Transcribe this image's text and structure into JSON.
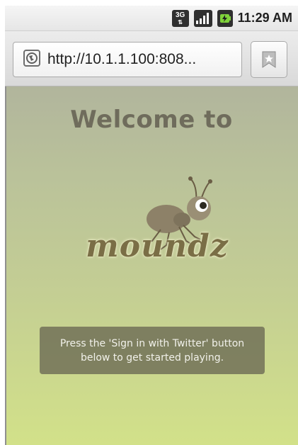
{
  "status_bar": {
    "network_type": "3G",
    "time": "11:29 AM",
    "icons": [
      "3g-data-icon",
      "signal-strength-icon",
      "battery-charging-icon"
    ]
  },
  "browser": {
    "url": "http://10.1.1.100:808...",
    "icons": [
      "site-globe-icon",
      "bookmark-star-icon"
    ]
  },
  "page": {
    "heading": "Welcome to",
    "logo_text": "moundz",
    "info_message": "Press the 'Sign in with Twitter' button below to get started playing."
  },
  "colors": {
    "background_top": "#b1b59c",
    "background_bottom": "#d2e189",
    "heading": "#6f6c5c",
    "logo": "#7a6e46",
    "info_box": "#6e6c56"
  }
}
